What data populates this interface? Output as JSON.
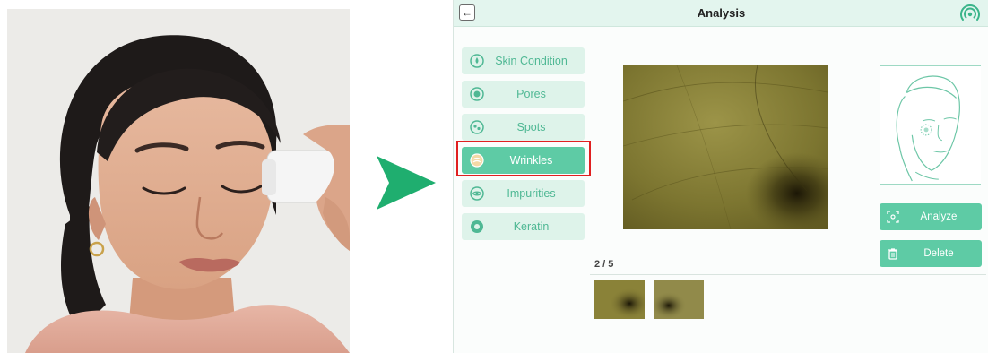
{
  "header": {
    "title": "Analysis",
    "back_icon": "back-arrow-icon",
    "status_icon": "signal-icon"
  },
  "menu": {
    "items": [
      {
        "label": "Skin Condition",
        "icon": "skin-condition-icon",
        "active": false
      },
      {
        "label": "Pores",
        "icon": "pores-icon",
        "active": false
      },
      {
        "label": "Spots",
        "icon": "spots-icon",
        "active": false
      },
      {
        "label": "Wrinkles",
        "icon": "wrinkles-icon",
        "active": true
      },
      {
        "label": "Impurities",
        "icon": "impurities-icon",
        "active": false
      },
      {
        "label": "Keratin",
        "icon": "keratin-icon",
        "active": false
      }
    ]
  },
  "actions": {
    "analyze_label": "Analyze",
    "delete_label": "Delete"
  },
  "gallery": {
    "counter": "2 / 5",
    "thumbnail_count": 2
  },
  "colors": {
    "accent": "#5ecba5",
    "accent_light": "#def3ea",
    "header_bg": "#e3f5ee",
    "highlight_outline": "#e02020",
    "arrow": "#1fae6f"
  }
}
